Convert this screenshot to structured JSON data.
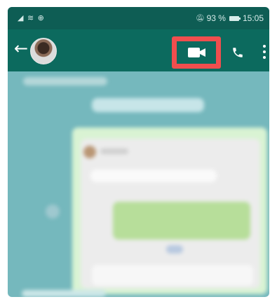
{
  "status_bar": {
    "left_icons": "◢ ≋ ⊕",
    "battery_percent": "93 %",
    "time": "15:05",
    "mute_icon": "bell-off-icon"
  },
  "app_bar": {
    "back_icon": "arrow-left-icon",
    "avatar": "contact-avatar",
    "video_call_icon": "video-camera-icon",
    "voice_call_icon": "phone-icon",
    "menu_icon": "more-vert-icon"
  },
  "colors": {
    "status_bar": "#0e5d54",
    "app_bar": "#0c6a5e",
    "highlight": "#f04e4e",
    "chat_background": "#75b8bd"
  }
}
